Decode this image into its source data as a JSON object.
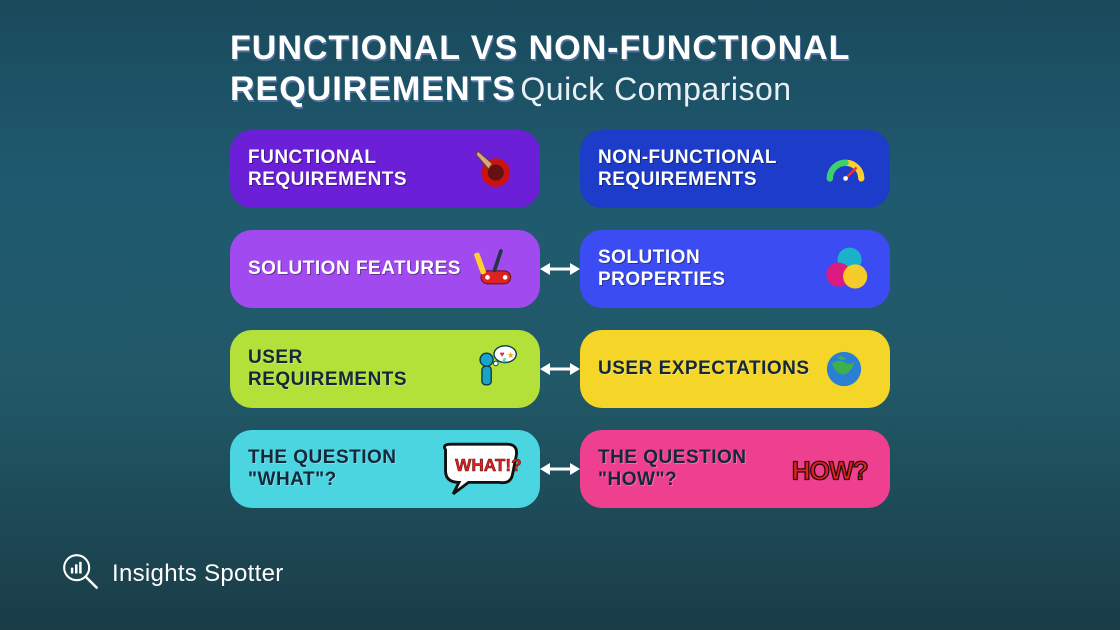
{
  "title": {
    "bold_line1": "FUNCTIONAL VS NON-FUNCTIONAL",
    "bold_line2": "REQUIREMENTS",
    "light": "Quick Comparison"
  },
  "rows": [
    {
      "left": "FUNCTIONAL REQUIREMENTS",
      "right": "NON-FUNCTIONAL REQUIREMENTS",
      "has_arrow": false,
      "left_color": "purple",
      "right_color": "blue",
      "left_icon": "button-press-icon",
      "right_icon": "gauge-icon"
    },
    {
      "left": "SOLUTION FEATURES",
      "right": "SOLUTION PROPERTIES",
      "has_arrow": true,
      "left_color": "violet",
      "right_color": "royal",
      "left_icon": "swiss-knife-icon",
      "right_icon": "venn-circles-icon"
    },
    {
      "left": "USER REQUIREMENTS",
      "right": "USER EXPECTATIONS",
      "has_arrow": true,
      "left_color": "lime",
      "right_color": "yellow",
      "left_icon": "person-thought-icon",
      "right_icon": "globe-icon"
    },
    {
      "left": "THE QUESTION \"WHAT\"?",
      "right": "THE QUESTION \"HOW\"?",
      "has_arrow": true,
      "left_color": "cyan",
      "right_color": "pink",
      "left_icon": "what-speech-icon",
      "right_icon": "how-speech-icon"
    }
  ],
  "footer": {
    "brand": "Insights Spotter"
  },
  "speech": {
    "what": "WHAT!?",
    "how": "HOW?"
  }
}
